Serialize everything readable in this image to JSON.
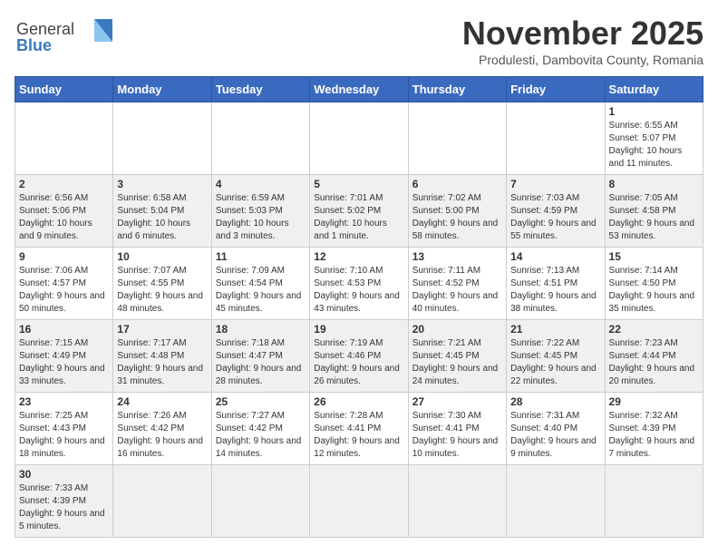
{
  "header": {
    "logo_general": "General",
    "logo_blue": "Blue",
    "title": "November 2025",
    "subtitle": "Produlesti, Dambovita County, Romania"
  },
  "calendar": {
    "days_of_week": [
      "Sunday",
      "Monday",
      "Tuesday",
      "Wednesday",
      "Thursday",
      "Friday",
      "Saturday"
    ],
    "weeks": [
      [
        {
          "day": "",
          "info": ""
        },
        {
          "day": "",
          "info": ""
        },
        {
          "day": "",
          "info": ""
        },
        {
          "day": "",
          "info": ""
        },
        {
          "day": "",
          "info": ""
        },
        {
          "day": "",
          "info": ""
        },
        {
          "day": "1",
          "info": "Sunrise: 6:55 AM\nSunset: 5:07 PM\nDaylight: 10 hours and 11 minutes."
        }
      ],
      [
        {
          "day": "2",
          "info": "Sunrise: 6:56 AM\nSunset: 5:06 PM\nDaylight: 10 hours and 9 minutes."
        },
        {
          "day": "3",
          "info": "Sunrise: 6:58 AM\nSunset: 5:04 PM\nDaylight: 10 hours and 6 minutes."
        },
        {
          "day": "4",
          "info": "Sunrise: 6:59 AM\nSunset: 5:03 PM\nDaylight: 10 hours and 3 minutes."
        },
        {
          "day": "5",
          "info": "Sunrise: 7:01 AM\nSunset: 5:02 PM\nDaylight: 10 hours and 1 minute."
        },
        {
          "day": "6",
          "info": "Sunrise: 7:02 AM\nSunset: 5:00 PM\nDaylight: 9 hours and 58 minutes."
        },
        {
          "day": "7",
          "info": "Sunrise: 7:03 AM\nSunset: 4:59 PM\nDaylight: 9 hours and 55 minutes."
        },
        {
          "day": "8",
          "info": "Sunrise: 7:05 AM\nSunset: 4:58 PM\nDaylight: 9 hours and 53 minutes."
        }
      ],
      [
        {
          "day": "9",
          "info": "Sunrise: 7:06 AM\nSunset: 4:57 PM\nDaylight: 9 hours and 50 minutes."
        },
        {
          "day": "10",
          "info": "Sunrise: 7:07 AM\nSunset: 4:55 PM\nDaylight: 9 hours and 48 minutes."
        },
        {
          "day": "11",
          "info": "Sunrise: 7:09 AM\nSunset: 4:54 PM\nDaylight: 9 hours and 45 minutes."
        },
        {
          "day": "12",
          "info": "Sunrise: 7:10 AM\nSunset: 4:53 PM\nDaylight: 9 hours and 43 minutes."
        },
        {
          "day": "13",
          "info": "Sunrise: 7:11 AM\nSunset: 4:52 PM\nDaylight: 9 hours and 40 minutes."
        },
        {
          "day": "14",
          "info": "Sunrise: 7:13 AM\nSunset: 4:51 PM\nDaylight: 9 hours and 38 minutes."
        },
        {
          "day": "15",
          "info": "Sunrise: 7:14 AM\nSunset: 4:50 PM\nDaylight: 9 hours and 35 minutes."
        }
      ],
      [
        {
          "day": "16",
          "info": "Sunrise: 7:15 AM\nSunset: 4:49 PM\nDaylight: 9 hours and 33 minutes."
        },
        {
          "day": "17",
          "info": "Sunrise: 7:17 AM\nSunset: 4:48 PM\nDaylight: 9 hours and 31 minutes."
        },
        {
          "day": "18",
          "info": "Sunrise: 7:18 AM\nSunset: 4:47 PM\nDaylight: 9 hours and 28 minutes."
        },
        {
          "day": "19",
          "info": "Sunrise: 7:19 AM\nSunset: 4:46 PM\nDaylight: 9 hours and 26 minutes."
        },
        {
          "day": "20",
          "info": "Sunrise: 7:21 AM\nSunset: 4:45 PM\nDaylight: 9 hours and 24 minutes."
        },
        {
          "day": "21",
          "info": "Sunrise: 7:22 AM\nSunset: 4:45 PM\nDaylight: 9 hours and 22 minutes."
        },
        {
          "day": "22",
          "info": "Sunrise: 7:23 AM\nSunset: 4:44 PM\nDaylight: 9 hours and 20 minutes."
        }
      ],
      [
        {
          "day": "23",
          "info": "Sunrise: 7:25 AM\nSunset: 4:43 PM\nDaylight: 9 hours and 18 minutes."
        },
        {
          "day": "24",
          "info": "Sunrise: 7:26 AM\nSunset: 4:42 PM\nDaylight: 9 hours and 16 minutes."
        },
        {
          "day": "25",
          "info": "Sunrise: 7:27 AM\nSunset: 4:42 PM\nDaylight: 9 hours and 14 minutes."
        },
        {
          "day": "26",
          "info": "Sunrise: 7:28 AM\nSunset: 4:41 PM\nDaylight: 9 hours and 12 minutes."
        },
        {
          "day": "27",
          "info": "Sunrise: 7:30 AM\nSunset: 4:41 PM\nDaylight: 9 hours and 10 minutes."
        },
        {
          "day": "28",
          "info": "Sunrise: 7:31 AM\nSunset: 4:40 PM\nDaylight: 9 hours and 9 minutes."
        },
        {
          "day": "29",
          "info": "Sunrise: 7:32 AM\nSunset: 4:39 PM\nDaylight: 9 hours and 7 minutes."
        }
      ],
      [
        {
          "day": "30",
          "info": "Sunrise: 7:33 AM\nSunset: 4:39 PM\nDaylight: 9 hours and 5 minutes."
        },
        {
          "day": "",
          "info": ""
        },
        {
          "day": "",
          "info": ""
        },
        {
          "day": "",
          "info": ""
        },
        {
          "day": "",
          "info": ""
        },
        {
          "day": "",
          "info": ""
        },
        {
          "day": "",
          "info": ""
        }
      ]
    ]
  }
}
